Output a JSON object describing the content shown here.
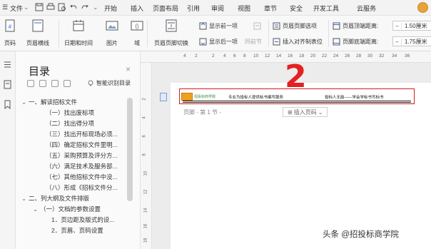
{
  "menubar": {
    "file_label": "文件",
    "tabs": [
      "开始",
      "插入",
      "页面布局",
      "引用",
      "审阅",
      "视图",
      "章节",
      "安全",
      "开发工具",
      "云服务"
    ],
    "active_tab": "页眉页脚"
  },
  "ribbon": {
    "page_num_label": "页码",
    "header_line_label": "页眉横线",
    "datetime_label": "日期和时间",
    "picture_label": "图片",
    "field_label": "域",
    "switch_label": "页眉页脚切换",
    "show_prev_label": "显示前一项",
    "show_next_label": "显示后一项",
    "same_prev_label": "同前节",
    "hf_options_label": "页眉页脚选项",
    "insert_align_tab_label": "插入对齐制表位",
    "header_top_distance_label": "页眉顶端距离:",
    "footer_bottom_distance_label": "页脚底端距离:",
    "header_top_value": "1.50厘米",
    "footer_bottom_value": "1.75厘米"
  },
  "toc": {
    "title": "目录",
    "smart_label": "智能识别目录",
    "items": [
      "一、解读招标文件",
      "（一）找出废标项",
      "（二）找出得分项",
      "（三）找出开标现场必须...",
      "（四）确定招标文件里明...",
      "（五）采购预算及评分方...",
      "（六）满足技术及服务部...",
      "（七）其他招标文件中没...",
      "（八）形成《招标文件分...",
      "二、列大纲及文件排版",
      "（一）文档的参数设置",
      "1．页边距及版式的设...",
      "2．页眉、页码设置"
    ]
  },
  "ruler": {
    "numbers": [
      "4",
      "2",
      "2",
      "4",
      "6",
      "8",
      "10",
      "12",
      "14",
      "16",
      "18",
      "20",
      "22",
      "24",
      "26",
      "28",
      "30",
      "32",
      "34",
      "36"
    ],
    "v_numbers": [
      "2",
      "4",
      "6",
      "8",
      "10",
      "12",
      "14",
      "16",
      "18"
    ]
  },
  "document": {
    "logo_text": "招投标商学院",
    "header_left_text": "专业为投标人提供标书编写服务",
    "header_right_text": "投标人无敌——学会学标书写标书",
    "annotation_number": "2",
    "footer_label": "页脚 - 第 1 节 -",
    "insert_page_label": "插入页码"
  },
  "watermark": "头条 @招投标商学院",
  "colors": {
    "accent_blue": "#2a6ee8",
    "annotation_red": "#e42020",
    "header_border": "#d01c1c"
  }
}
